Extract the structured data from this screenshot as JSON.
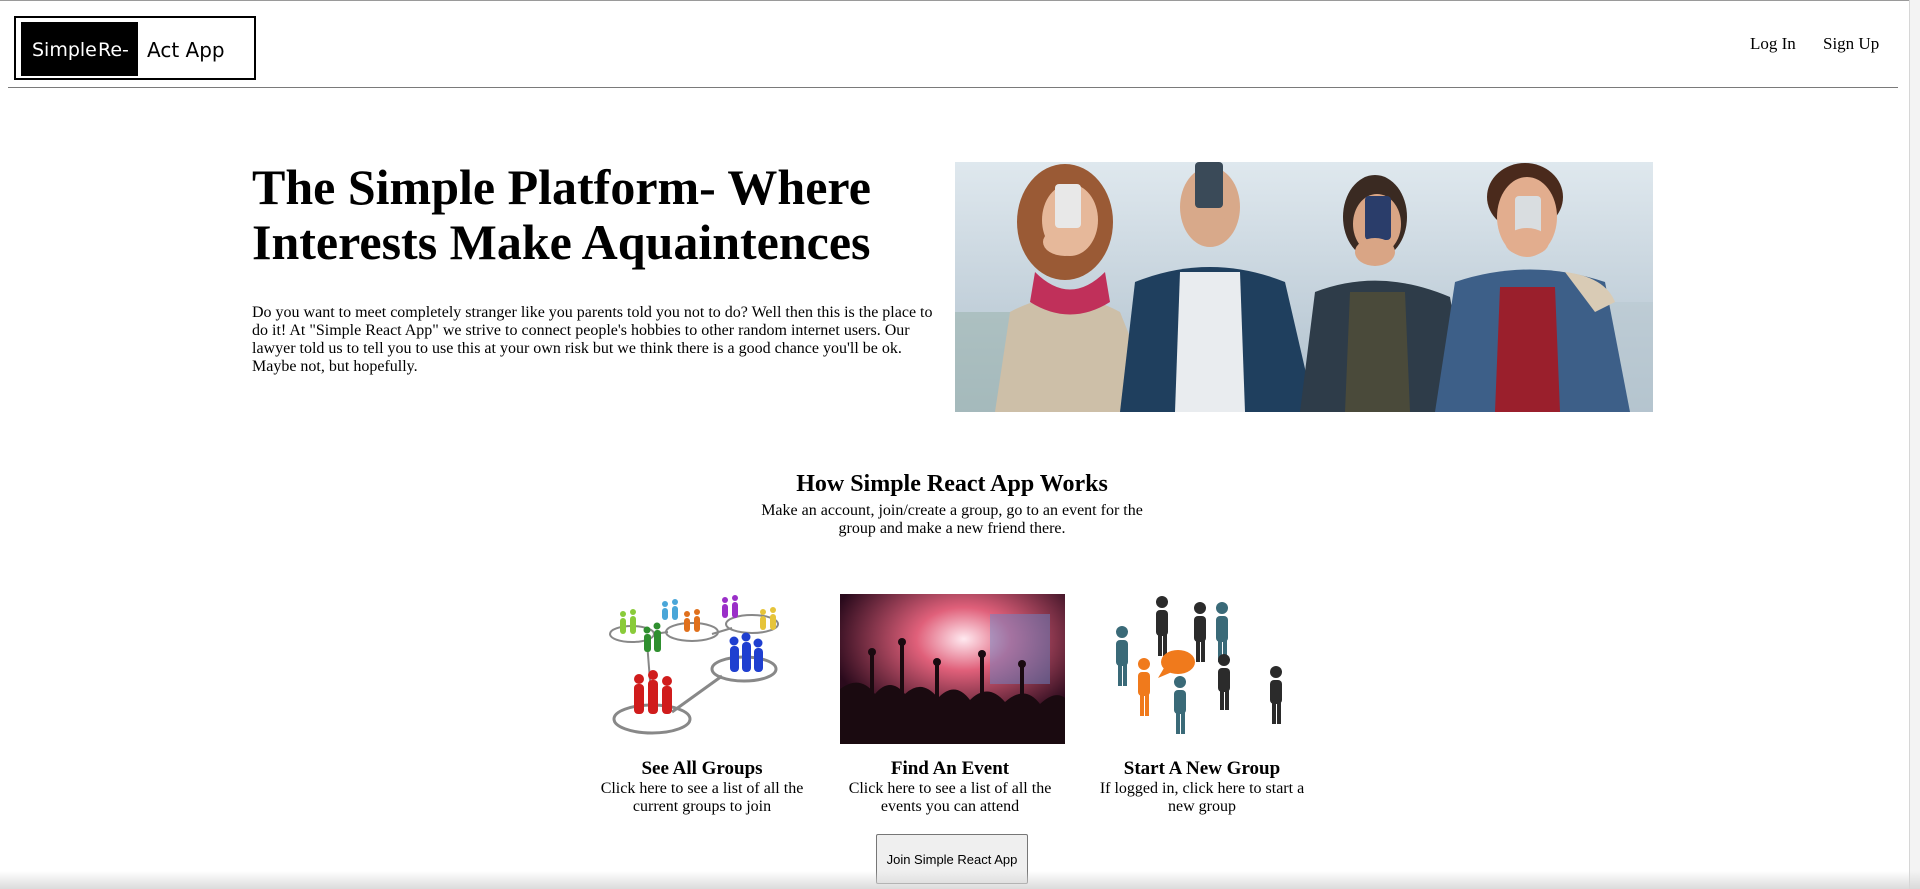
{
  "header": {
    "logo": {
      "part1": "Simple",
      "part2": "Re-",
      "part3": "Act App"
    },
    "nav": {
      "login": "Log In",
      "signup": "Sign Up"
    }
  },
  "hero": {
    "title": "The Simple Platform- Where Interests Make Aquaintences",
    "text": "Do you want to meet completely stranger like you parents told you not to do? Well then this is the place to do it! At \"Simple React App\" we strive to connect people's hobbies to other random internet users. Our lawyer told us to tell you to use this at your own risk but we think there is a good chance you'll be ok. Maybe not, but hopefully."
  },
  "how": {
    "title": "How Simple React App Works",
    "text": "Make an account, join/create a group, go to an event for the group and make a new friend there."
  },
  "cards": [
    {
      "title": "See All Groups",
      "desc": "Click here to see a list of all the current groups to join"
    },
    {
      "title": "Find An Event",
      "desc": "Click here to see a list of all the events you can attend"
    },
    {
      "title": "Start A New Group",
      "desc": "If logged in, click here to start a new group"
    }
  ],
  "cta": {
    "join_label": "Join Simple React App"
  },
  "icons": {
    "hero_image": "people-holding-phones-photo",
    "groups_image": "people-network-illustration",
    "event_image": "concert-crowd-photo",
    "new_group_image": "people-chat-bubble-illustration"
  }
}
